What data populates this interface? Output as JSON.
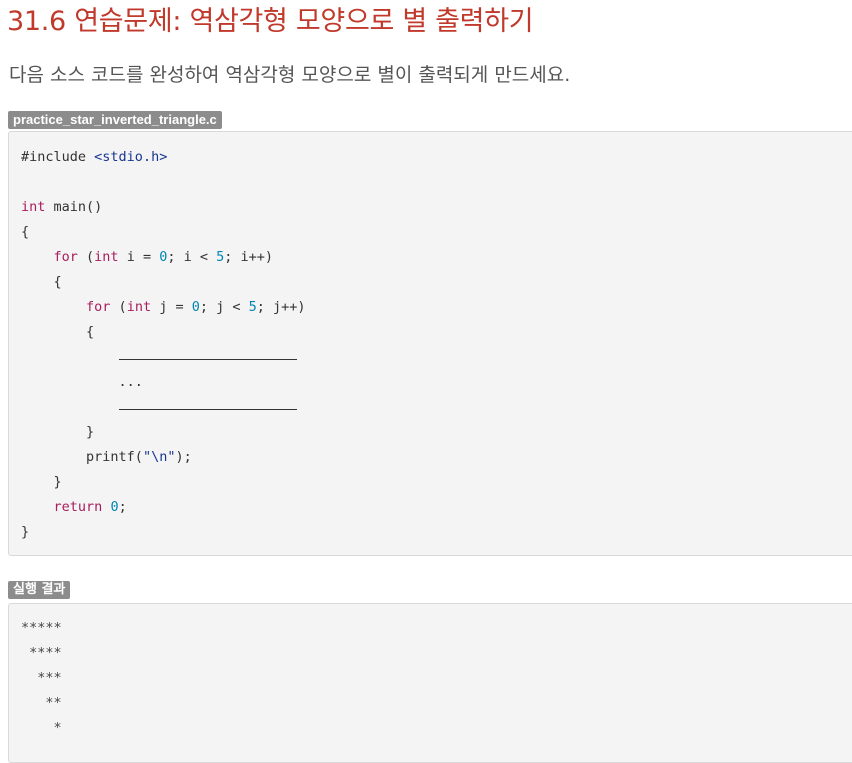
{
  "title": "31.6 연습문제: 역삼각형 모양으로 별 출력하기",
  "description": "다음 소스 코드를 완성하여 역삼각형 모양으로 별이 출력되게 만드세요.",
  "code_label": "practice_star_inverted_triangle.c",
  "result_label": "실행 결과",
  "code": {
    "include_directive": "#include",
    "include_header": "<stdio.h>",
    "type_int": "int",
    "main_sig": " main()",
    "open_brace": "{",
    "close_brace": "}",
    "for_kw": "for",
    "outer_loop_a": " (",
    "outer_loop_b": " i = ",
    "outer_loop_c": "; i < ",
    "outer_loop_d": "; i++)",
    "inner_loop_b": " j = ",
    "inner_loop_c": "; j < ",
    "inner_loop_d": "; j++)",
    "zero": "0",
    "five": "5",
    "ellipsis": "...",
    "printf_call": "printf(",
    "newline_str": "\"\\n\"",
    "printf_end": ");",
    "return_kw": "return",
    "return_end": ";"
  },
  "output": [
    "*****",
    " ****",
    "  ***",
    "   **",
    "    *"
  ]
}
